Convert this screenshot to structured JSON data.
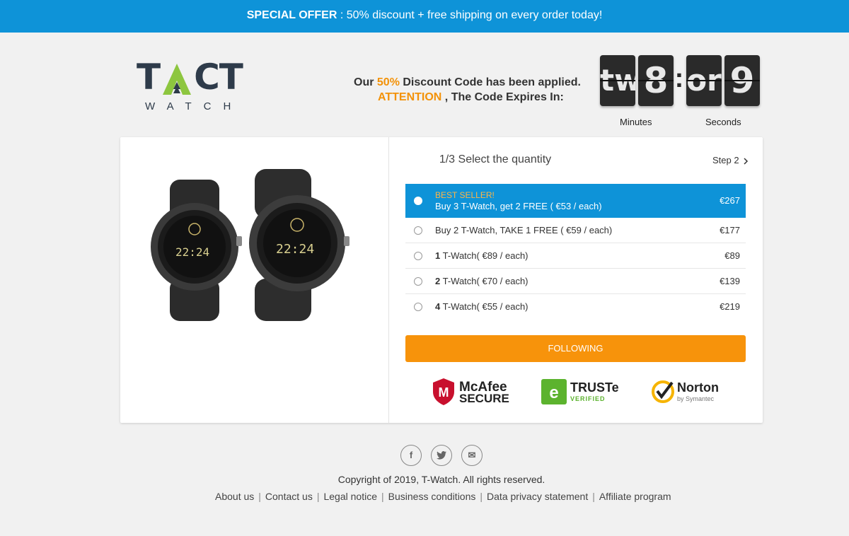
{
  "topbar": {
    "strong": "SPECIAL OFFER",
    "rest": " : 50% discount + free shipping on every order today!"
  },
  "logo": {
    "main_left": "T",
    "main_right": "CT",
    "sub": "WATCH"
  },
  "code_message": {
    "line1_a": "Our ",
    "line1_pct": "50%",
    "line1_b": " Discount Code has been applied.",
    "line2_attn": "ATTENTION",
    "line2_b": " , The Code Expires In:"
  },
  "timer": {
    "min_tens": "tw",
    "min_ones": "8",
    "sec_tens": "or",
    "sec_ones": "9",
    "min_label": "Minutes",
    "sec_label": "Seconds"
  },
  "step": {
    "title": "1/3 Select the quantity",
    "next": "Step 2",
    "next_icon": "chevron-right-icon"
  },
  "options": [
    {
      "tag": "BEST SELLER!",
      "text": "Buy 3 T-Watch, get 2 FREE ( €53 / each)",
      "price": "€267",
      "selected": true
    },
    {
      "text": "Buy 2 T-Watch, TAKE 1 FREE ( €59 / each)",
      "price": "€177"
    },
    {
      "qty": "1",
      "text": " T-Watch( €89 / each)",
      "price": "€89"
    },
    {
      "qty": "2",
      "text": " T-Watch( €70 / each)",
      "price": "€139"
    },
    {
      "qty": "4",
      "text": " T-Watch( €55 / each)",
      "price": "€219"
    }
  ],
  "button": {
    "label": "FOLLOWING"
  },
  "badges": {
    "mcafee_1": "McAfee",
    "mcafee_2": "SECURE",
    "truste_1": "TRUSTe",
    "truste_2": "VERIFIED",
    "norton_1": "Norton",
    "norton_2": "by Symantec"
  },
  "socials": {
    "facebook": "f",
    "twitter": "t",
    "email": "✉"
  },
  "footer": {
    "copyright": "Copyright of 2019, T-Watch. All rights reserved.",
    "links": [
      "About us",
      "Contact us",
      "Legal notice",
      "Business conditions",
      "Data privacy statement",
      "Affiliate program"
    ]
  },
  "colors": {
    "blue": "#0e93d8",
    "orange": "#f7930b",
    "dark": "#2e3b4a"
  }
}
